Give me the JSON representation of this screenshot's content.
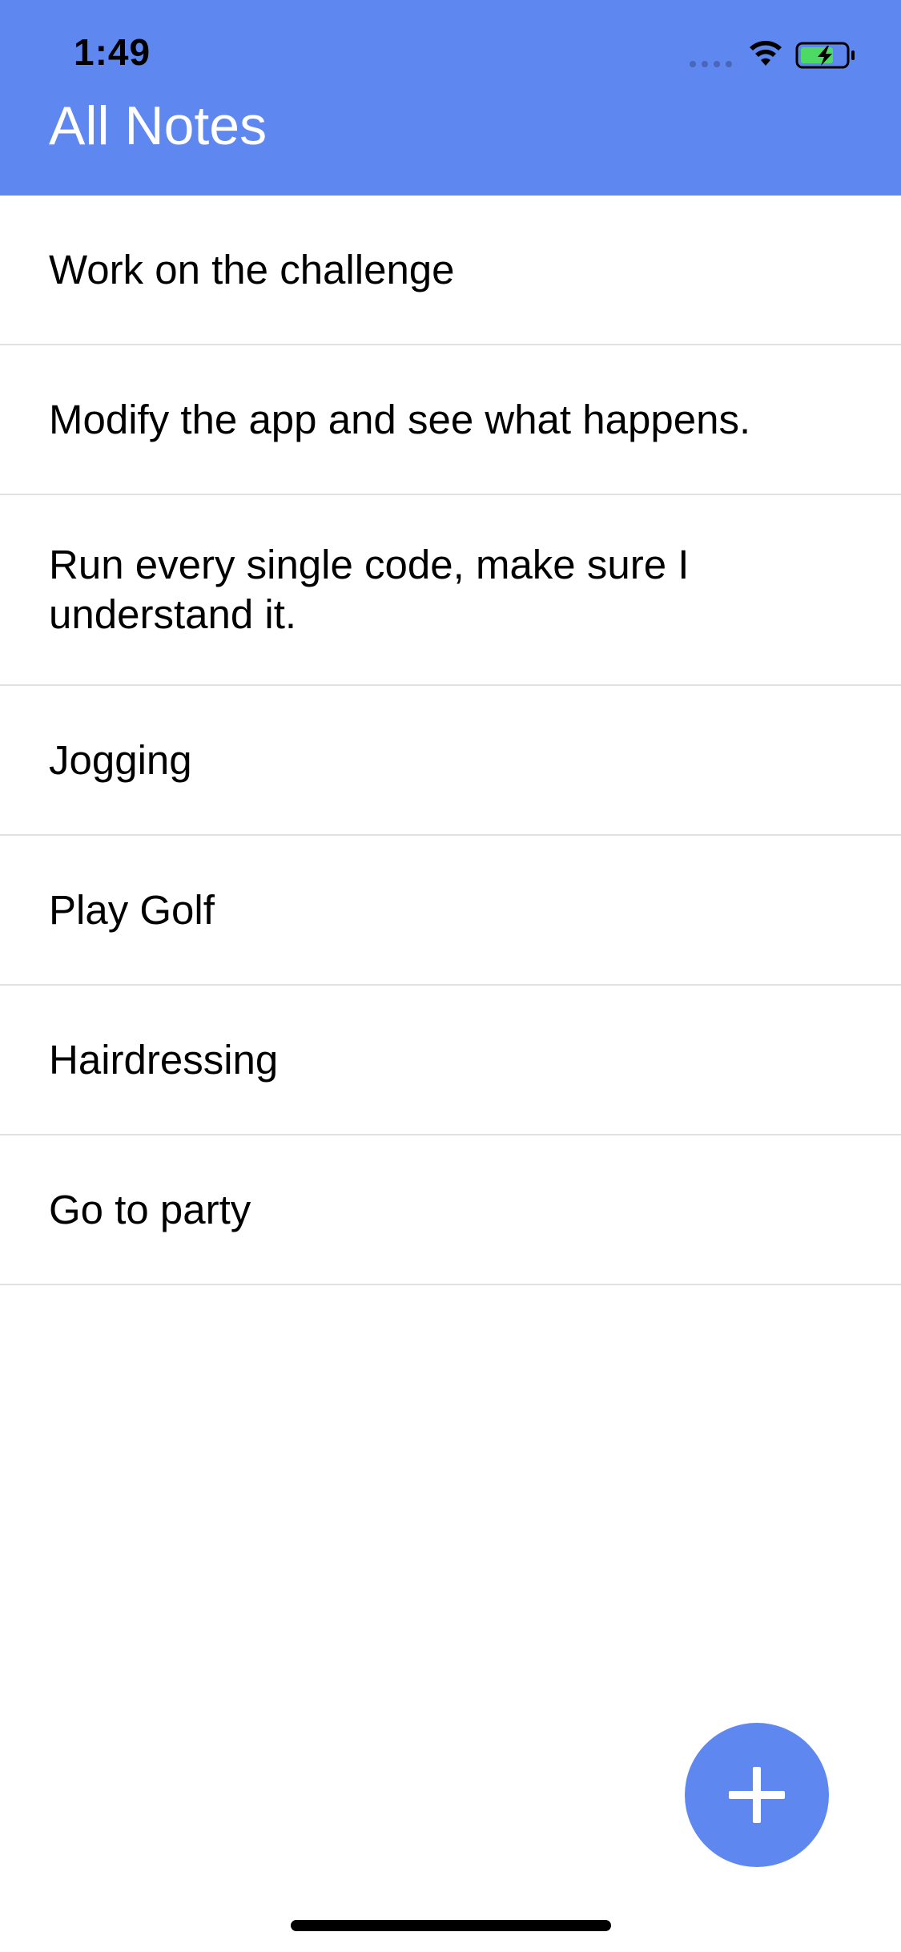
{
  "status_bar": {
    "time": "1:49",
    "icons": [
      "signal-dots-icon",
      "wifi-icon",
      "battery-charging-icon"
    ]
  },
  "header": {
    "title": "All Notes",
    "background_color": "#5f87f0"
  },
  "notes": [
    {
      "text": "Work on the challenge"
    },
    {
      "text": "Modify the app and see what happens."
    },
    {
      "text": "Run every single code, make sure I understand it."
    },
    {
      "text": "Jogging"
    },
    {
      "text": "Play Golf"
    },
    {
      "text": "Hairdressing"
    },
    {
      "text": "Go to party"
    }
  ],
  "fab": {
    "icon": "plus-icon",
    "color": "#5f87f0"
  },
  "colors": {
    "accent": "#5f87f0",
    "battery_fill": "#4cd964",
    "divider": "#e1e1e1"
  }
}
